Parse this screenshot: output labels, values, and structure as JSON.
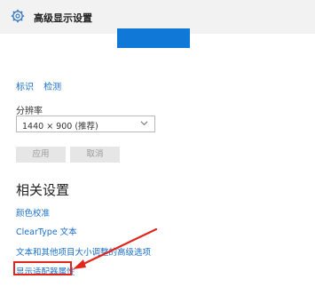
{
  "window": {
    "title": "高级显示设置",
    "settings_icon": "gear-icon"
  },
  "display_preview": {
    "color": "#1079d8"
  },
  "monitor_links": {
    "identify": "标识",
    "detect": "检测"
  },
  "resolution": {
    "label": "分辨率",
    "selected": "1440 × 900 (推荐)",
    "dropdown_icon": "chevron-down-icon"
  },
  "buttons": {
    "apply": "应用",
    "cancel": "取消"
  },
  "related": {
    "heading": "相关设置",
    "items": [
      "颜色校准",
      "ClearType 文本",
      "文本和其他项目大小调整的高级选项",
      "显示适配器属性"
    ]
  },
  "annotation": {
    "color": "#e0261c"
  }
}
